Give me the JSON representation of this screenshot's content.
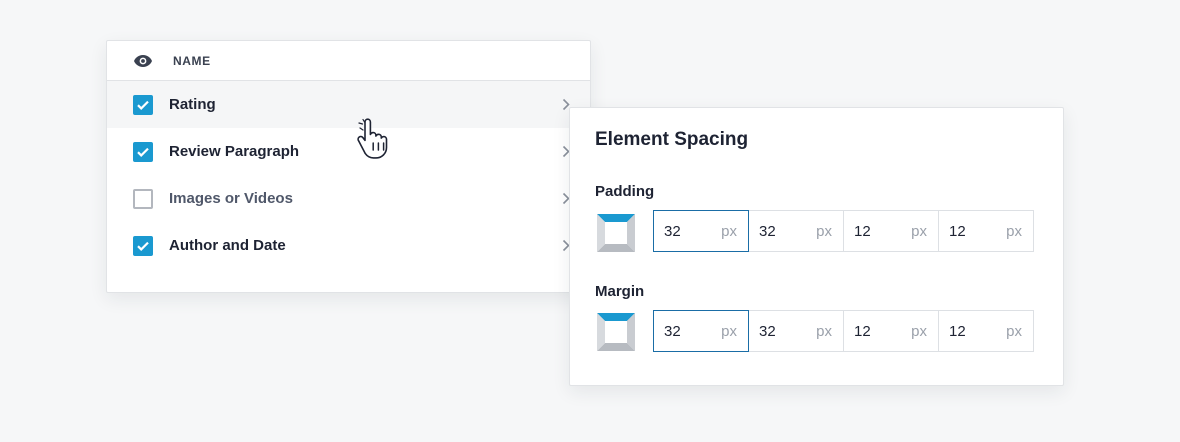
{
  "fields_panel": {
    "column_header": "NAME",
    "rows": [
      {
        "label": "Rating",
        "checked": true,
        "hovered": true
      },
      {
        "label": "Review Paragraph",
        "checked": true,
        "hovered": false
      },
      {
        "label": "Images or Videos",
        "checked": false,
        "hovered": false
      },
      {
        "label": "Author and Date",
        "checked": true,
        "hovered": false
      }
    ]
  },
  "spacing_panel": {
    "title": "Element Spacing",
    "padding": {
      "label": "Padding",
      "values": [
        "32",
        "32",
        "12",
        "12"
      ],
      "unit": "px"
    },
    "margin": {
      "label": "Margin",
      "values": [
        "32",
        "32",
        "12",
        "12"
      ],
      "unit": "px"
    }
  },
  "colors": {
    "accent": "#1a99d0",
    "active_border": "#1a6da6"
  },
  "icons": [
    "eye-icon",
    "checkmark-icon",
    "chevron-right-icon",
    "box-spacing-icon",
    "hand-pointer-icon"
  ]
}
